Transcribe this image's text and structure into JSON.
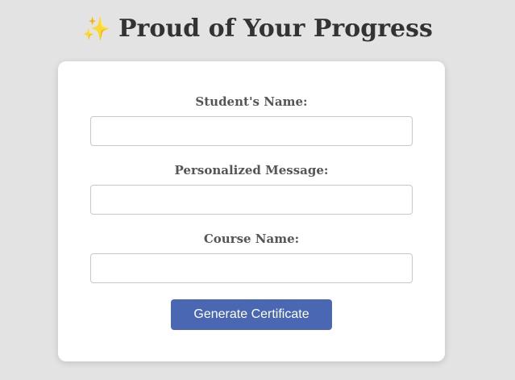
{
  "header": {
    "icon": "sparkles-icon",
    "icon_glyph": "✨",
    "title": "Proud of Your Progress"
  },
  "form": {
    "fields": [
      {
        "label": "Student's Name:",
        "value": "",
        "placeholder": ""
      },
      {
        "label": "Personalized Message:",
        "value": "",
        "placeholder": ""
      },
      {
        "label": "Course Name:",
        "value": "",
        "placeholder": ""
      }
    ],
    "submit_label": "Generate Certificate"
  },
  "colors": {
    "background": "#e3e3e3",
    "card": "#ffffff",
    "button": "#4a67b4",
    "title_text": "#333333",
    "label_text": "#555555"
  }
}
